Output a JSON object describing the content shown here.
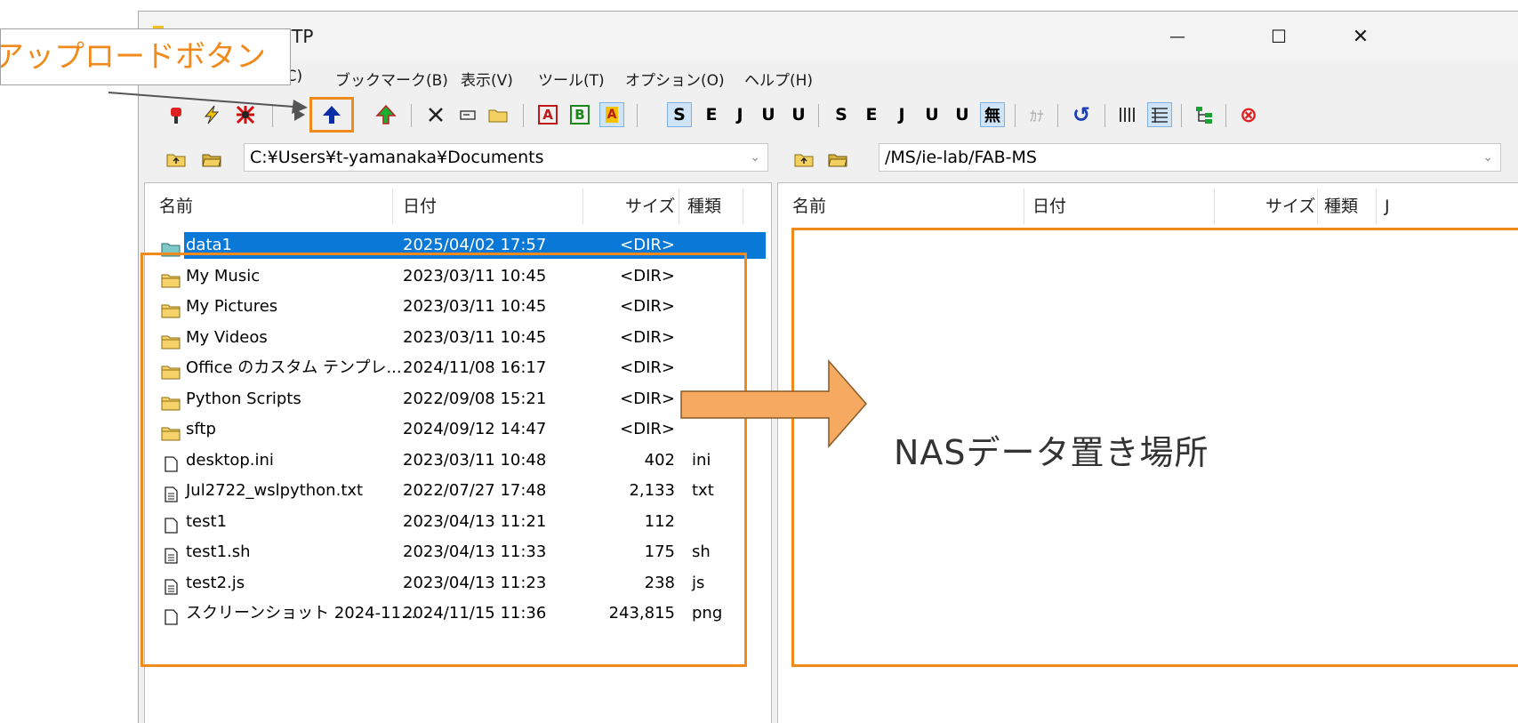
{
  "window": {
    "title": "NAS (1) - FFFTP",
    "minimize_glyph": "—",
    "maximize_glyph": "☐",
    "close_glyph": "✕"
  },
  "menu": [
    {
      "label": "(C)"
    },
    {
      "label": "ブックマーク(B)"
    },
    {
      "label": "表示(V)"
    },
    {
      "label": "ツール(T)"
    },
    {
      "label": "オプション(O)"
    },
    {
      "label": "ヘルプ(H)"
    }
  ],
  "toolbar": {
    "icons": [
      "connect-icon",
      "quick-connect-icon",
      "disconnect-icon",
      "download-icon",
      "upload-icon",
      "mirror-upload-icon",
      "delete-icon",
      "rename-icon",
      "mkdir-icon"
    ],
    "mode_a": "A",
    "mode_b": "B",
    "mode_auto": "A",
    "kanji": [
      "S",
      "E",
      "J",
      "U",
      "U"
    ],
    "kanji_remote": [
      "S",
      "E",
      "J",
      "U",
      "U",
      "無"
    ],
    "kana": "ｶﾅ",
    "refresh_glyph": "↺",
    "stop_glyph": "⊗"
  },
  "local": {
    "path": "C:¥Users¥t-yamanaka¥Documents",
    "columns": {
      "name": "名前",
      "date": "日付",
      "size": "サイズ",
      "type": "種類"
    },
    "files": [
      {
        "name": "data1",
        "date": "2025/04/02 17:57",
        "size": "<DIR>",
        "type": "",
        "kind": "folder-teal"
      },
      {
        "name": "My Music",
        "date": "2023/03/11 10:45",
        "size": "<DIR>",
        "type": "",
        "kind": "folder"
      },
      {
        "name": "My Pictures",
        "date": "2023/03/11 10:45",
        "size": "<DIR>",
        "type": "",
        "kind": "folder"
      },
      {
        "name": "My Videos",
        "date": "2023/03/11 10:45",
        "size": "<DIR>",
        "type": "",
        "kind": "folder"
      },
      {
        "name": "Office のカスタム テンプレ...",
        "date": "2024/11/08 16:17",
        "size": "<DIR>",
        "type": "",
        "kind": "folder"
      },
      {
        "name": "Python Scripts",
        "date": "2022/09/08 15:21",
        "size": "<DIR>",
        "type": "",
        "kind": "folder"
      },
      {
        "name": "sftp",
        "date": "2024/09/12 14:47",
        "size": "<DIR>",
        "type": "",
        "kind": "folder"
      },
      {
        "name": "desktop.ini",
        "date": "2023/03/11 10:48",
        "size": "402",
        "type": "ini",
        "kind": "file"
      },
      {
        "name": "Jul2722_wslpython.txt",
        "date": "2022/07/27 17:48",
        "size": "2,133",
        "type": "txt",
        "kind": "text"
      },
      {
        "name": "test1",
        "date": "2023/04/13 11:21",
        "size": "112",
        "type": "",
        "kind": "file"
      },
      {
        "name": "test1.sh",
        "date": "2023/04/13 11:33",
        "size": "175",
        "type": "sh",
        "kind": "text"
      },
      {
        "name": "test2.js",
        "date": "2023/04/13 11:23",
        "size": "238",
        "type": "js",
        "kind": "text"
      },
      {
        "name": "スクリーンショット 2024-11...",
        "date": "2024/11/15 11:36",
        "size": "243,815",
        "type": "png",
        "kind": "file"
      }
    ]
  },
  "remote": {
    "path": "/MS/ie-lab/FAB-MS",
    "columns": {
      "name": "名前",
      "date": "日付",
      "size": "サイズ",
      "type": "種類",
      "extra": "J"
    }
  },
  "annotations": {
    "callout": "アップロードボタン",
    "drop_area": "NASデータ置き場所"
  }
}
